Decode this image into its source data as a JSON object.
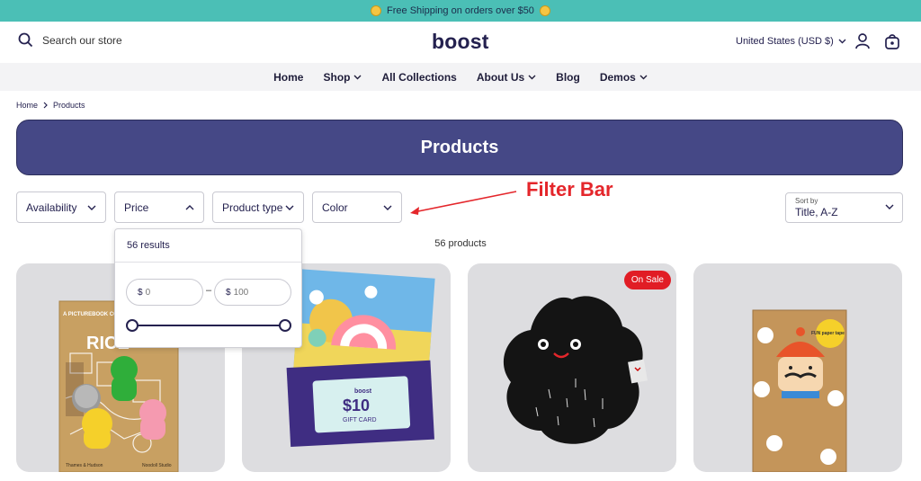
{
  "announcement": {
    "text": "Free Shipping on orders over $50"
  },
  "header": {
    "search_placeholder": "Search our store",
    "logo": "boost",
    "currency": "United States (USD $)"
  },
  "nav": [
    {
      "label": "Home",
      "has_dropdown": false
    },
    {
      "label": "Shop",
      "has_dropdown": true
    },
    {
      "label": "All Collections",
      "has_dropdown": false
    },
    {
      "label": "About Us",
      "has_dropdown": true
    },
    {
      "label": "Blog",
      "has_dropdown": false
    },
    {
      "label": "Demos",
      "has_dropdown": true
    }
  ],
  "breadcrumb": {
    "home": "Home",
    "current": "Products"
  },
  "page_title": "Products",
  "filters": {
    "availability": "Availability",
    "price": "Price",
    "product_type": "Product type",
    "color": "Color"
  },
  "annotation": {
    "label": "Filter Bar",
    "color": "#e4262b"
  },
  "sort": {
    "label": "Sort by",
    "value": "Title, A-Z"
  },
  "product_count": "56 products",
  "price_dropdown": {
    "results": "56 results",
    "currency_symbol": "$",
    "min_placeholder": "0",
    "max_placeholder": "100",
    "range_fraction": [
      0,
      1
    ]
  },
  "products": [
    {
      "name": "book",
      "badge": "",
      "cover_title": "RICE",
      "cover_top": "A PICTUREBOOK COLLE...",
      "publisher": "Thames & Hudson",
      "studio": "Noodoll Studio"
    },
    {
      "name": "gift-card",
      "badge": "",
      "brand": "boost",
      "amount": "$10",
      "caption": "GIFT CARD"
    },
    {
      "name": "plush",
      "badge": "On Sale"
    },
    {
      "name": "paper-tape",
      "badge": "",
      "box_text": "FUN paper tape"
    }
  ],
  "colors": {
    "accent": "#454886",
    "announcement": "#4bbfb6",
    "sale": "#e11d25",
    "text": "#24214f"
  }
}
